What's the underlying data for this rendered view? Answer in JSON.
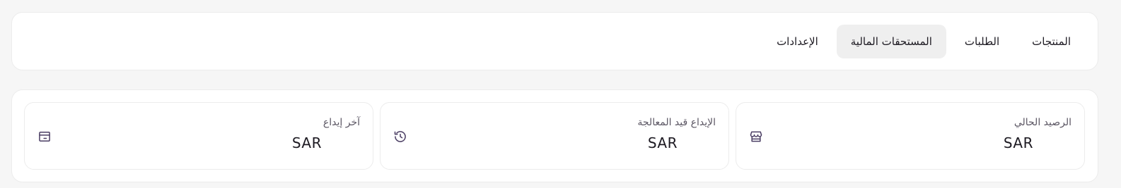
{
  "nav": {
    "tabs": [
      {
        "label": "المنتجات",
        "active": false
      },
      {
        "label": "الطلبات",
        "active": false
      },
      {
        "label": "المستحقات المالية",
        "active": true
      },
      {
        "label": "الإعدادات",
        "active": false
      }
    ]
  },
  "stats": [
    {
      "label": "الرصيد الحالي",
      "value": "SAR",
      "icon": "store-icon"
    },
    {
      "label": "الإيداع قيد المعالجة",
      "value": "SAR",
      "icon": "history-icon"
    },
    {
      "label": "آخر إيداع",
      "value": "SAR",
      "icon": "card-icon"
    }
  ],
  "colors": {
    "page_bg": "#f6f6f6",
    "card_bg": "#ffffff",
    "active_tab_bg": "#efefef",
    "icon": "#4a3d63"
  }
}
